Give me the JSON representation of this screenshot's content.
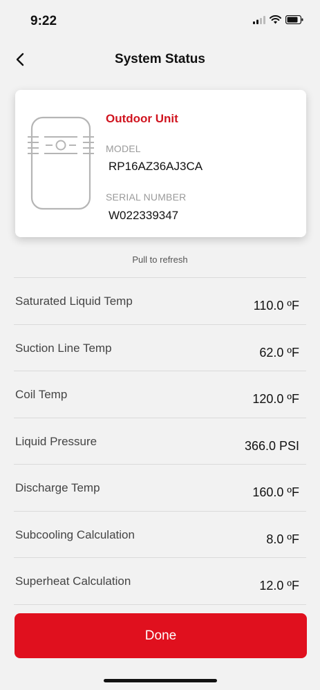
{
  "status_bar": {
    "time": "9:22"
  },
  "nav": {
    "title": "System Status",
    "back_icon": "chevron-left-icon"
  },
  "unit": {
    "name": "Outdoor Unit",
    "icon": "outdoor-unit-icon",
    "model_label": "MODEL",
    "model_value": "RP16AZ36AJ3CA",
    "serial_label": "SERIAL NUMBER",
    "serial_value": "W022339347"
  },
  "pull_to_refresh": "Pull to refresh",
  "readings": [
    {
      "label": "Saturated Liquid Temp",
      "value": "110.0 ºF"
    },
    {
      "label": "Suction Line Temp",
      "value": "62.0 ºF"
    },
    {
      "label": "Coil Temp",
      "value": "120.0 ºF"
    },
    {
      "label": "Liquid Pressure",
      "value": "366.0 PSI"
    },
    {
      "label": "Discharge Temp",
      "value": "160.0 ºF"
    },
    {
      "label": "Subcooling Calculation",
      "value": "8.0 ºF"
    },
    {
      "label": "Superheat Calculation",
      "value": "12.0 ºF"
    }
  ],
  "done_label": "Done",
  "colors": {
    "accent": "#e0101e",
    "brand_red": "#d0141f",
    "background": "#f2f2f2"
  }
}
